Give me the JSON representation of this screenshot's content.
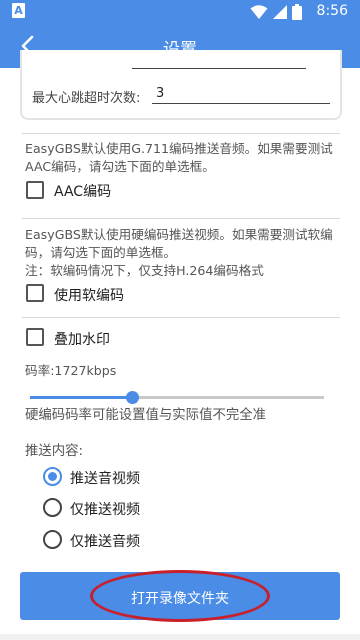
{
  "status_bar": {
    "notification_letter": "A",
    "time": "8:56",
    "icons": [
      "wifi-icon",
      "signal-icon",
      "battery-icon"
    ]
  },
  "app_bar": {
    "title": "设置",
    "back_icon": "back-arrow-icon"
  },
  "heartbeat": {
    "label": "最大心跳超时次数:",
    "value": "3"
  },
  "audio": {
    "description": "EasyGBS默认使用G.711编码推送音频。如果需要测试AAC编码，请勾选下面的单选框。",
    "checkbox_label": "AAC编码",
    "checked": false
  },
  "video": {
    "description": "EasyGBS默认使用硬编码推送视频。如果需要测试软编码，请勾选下面的单选框。",
    "note": "注：软编码情况下，仅支持H.264编码格式",
    "checkbox_label": "使用软编码",
    "checked": false
  },
  "watermark": {
    "checkbox_label": "叠加水印",
    "checked": false
  },
  "bitrate": {
    "label": "码率:1727kbps",
    "value_kbps": 1727,
    "slider_fraction": 0.35,
    "hint": "硬编码码率可能设置值与实际值不完全准"
  },
  "push_content": {
    "label": "推送内容:",
    "options": [
      {
        "label": "推送音视频",
        "selected": true
      },
      {
        "label": "仅推送视频",
        "selected": false
      },
      {
        "label": "仅推送音频",
        "selected": false
      }
    ]
  },
  "open_folder_button": {
    "label": "打开录像文件夹"
  },
  "colors": {
    "primary": "#4a8ce6",
    "highlight_annotation": "#c8202b"
  }
}
